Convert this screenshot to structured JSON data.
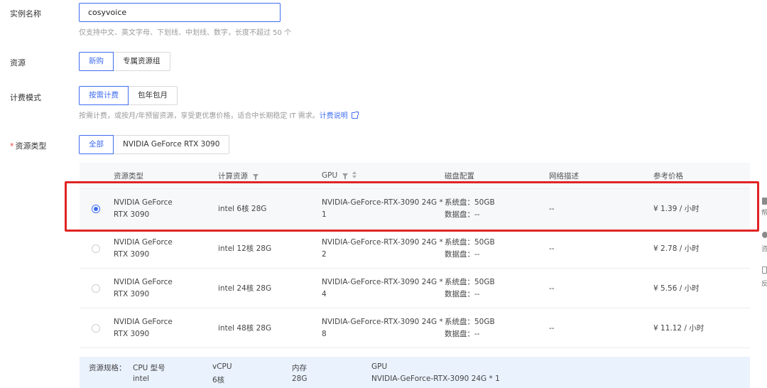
{
  "form": {
    "instance_name_label": "实例名称",
    "instance_name_value": "cosyvoice",
    "instance_name_hint": "仅支持中文、英文字母、下划线、中划线、数字，长度不超过 50 个",
    "resource_label": "资源",
    "resource_options": [
      "新购",
      "专属资源组"
    ],
    "billing_label": "计费模式",
    "billing_options": [
      "按需计费",
      "包年包月"
    ],
    "billing_hint": "按需计费，或按月/年预留资源，享受更优惠价格，适合中长期稳定 IT 需求。",
    "billing_link": "计费说明",
    "resource_type_star": "*",
    "resource_type_label": "资源类型",
    "resource_type_options": [
      "全部",
      "NVIDIA GeForce RTX 3090"
    ]
  },
  "table": {
    "headers": [
      "资源类型",
      "计算资源",
      "GPU",
      "磁盘配置",
      "网络描述",
      "参考价格"
    ],
    "rows": [
      {
        "type_line1": "NVIDIA GeForce",
        "type_line2": "RTX 3090",
        "compute": "intel 6核 28G",
        "gpu_line1": "NVIDIA-GeForce-RTX-3090 24G *",
        "gpu_line2": "1",
        "disk_line1": "系统盘：50GB",
        "disk_line2": "数据盘：--",
        "network": "--",
        "price": "¥ 1.39 / 小时",
        "selected": true
      },
      {
        "type_line1": "NVIDIA GeForce",
        "type_line2": "RTX 3090",
        "compute": "intel 12核 28G",
        "gpu_line1": "NVIDIA-GeForce-RTX-3090 24G *",
        "gpu_line2": "2",
        "disk_line1": "系统盘：50GB",
        "disk_line2": "数据盘：--",
        "network": "--",
        "price": "¥ 2.78 / 小时",
        "selected": false
      },
      {
        "type_line1": "NVIDIA GeForce",
        "type_line2": "RTX 3090",
        "compute": "intel 24核 28G",
        "gpu_line1": "NVIDIA-GeForce-RTX-3090 24G *",
        "gpu_line2": "4",
        "disk_line1": "系统盘：50GB",
        "disk_line2": "数据盘：--",
        "network": "--",
        "price": "¥ 5.56 / 小时",
        "selected": false
      },
      {
        "type_line1": "NVIDIA GeForce",
        "type_line2": "RTX 3090",
        "compute": "intel 48核 28G",
        "gpu_line1": "NVIDIA-GeForce-RTX-3090 24G *",
        "gpu_line2": "8",
        "disk_line1": "系统盘：50GB",
        "disk_line2": "数据盘：--",
        "network": "--",
        "price": "¥ 11.12 / 小时",
        "selected": false
      }
    ]
  },
  "spec": {
    "label": "资源规格：",
    "cpu_title": "CPU 型号",
    "cpu_value": "intel",
    "vcpu_title": "vCPU",
    "vcpu_value": "6核",
    "mem_title": "内存",
    "mem_value": "28G",
    "gpu_title": "GPU",
    "gpu_value": "NVIDIA-GeForce-RTX-3090 24G * 1"
  },
  "side_tabs": [
    "帮",
    "咨",
    "反"
  ],
  "colors": {
    "accent": "#3e6cf0",
    "highlight": "#e02424",
    "spec_bg": "#eaf2fd"
  }
}
